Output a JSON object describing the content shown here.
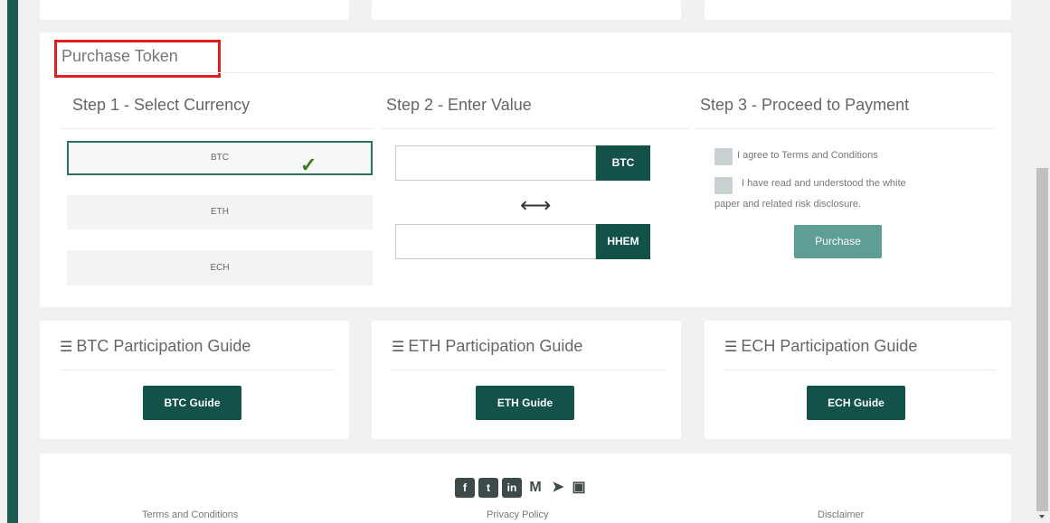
{
  "purchase": {
    "title": "Purchase Token",
    "step1": {
      "title": "Step 1 - Select Currency",
      "options": [
        "BTC",
        "ETH",
        "ECH"
      ],
      "selected": "BTC"
    },
    "step2": {
      "title": "Step 2 - Enter Value",
      "from_value": "",
      "from_unit": "BTC",
      "to_value": "",
      "to_unit": "HHEM"
    },
    "step3": {
      "title": "Step 3 - Proceed to Payment",
      "agree_terms": "I agree to Terms and Conditions",
      "read_whitepaper_line1": "I have read and understood the white",
      "read_whitepaper_line2": "paper and related risk disclosure.",
      "purchase_button": "Purchase"
    }
  },
  "guides": [
    {
      "title": "BTC Participation Guide",
      "button": "BTC Guide"
    },
    {
      "title": "ETH Participation Guide",
      "button": "ETH Guide"
    },
    {
      "title": "ECH Participation Guide",
      "button": "ECH Guide"
    }
  ],
  "footer": {
    "social_icons": [
      "facebook-icon",
      "twitter-icon",
      "linkedin-icon",
      "medium-icon",
      "telegram-icon",
      "youtube-icon"
    ],
    "links": [
      "Terms and Conditions",
      "Privacy Policy",
      "Disclaimer"
    ]
  },
  "colors": {
    "accent": "#125248",
    "highlight": "#e02020",
    "purchase_button": "#5f9e95"
  }
}
